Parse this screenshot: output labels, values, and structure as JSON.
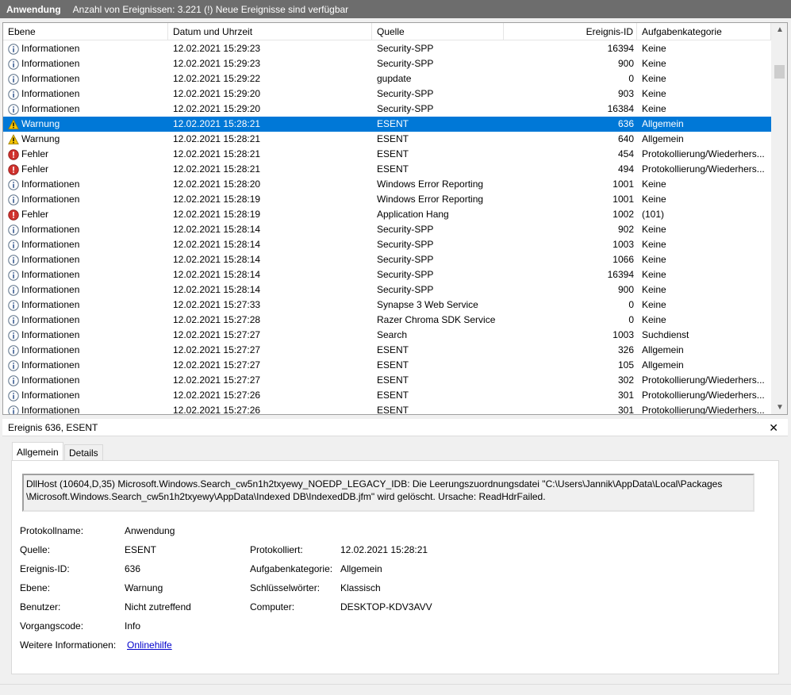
{
  "title": {
    "app_name": "Anwendung",
    "count_text": "Anzahl von Ereignissen: 3.221 (!) Neue Ereignisse sind verfügbar"
  },
  "columns": {
    "level": "Ebene",
    "date": "Datum und Uhrzeit",
    "source": "Quelle",
    "event_id": "Ereignis-ID",
    "category": "Aufgabenkategorie"
  },
  "events": [
    {
      "level": "Informationen",
      "icon": "info",
      "date": "12.02.2021 15:29:23",
      "source": "Security-SPP",
      "id": "16394",
      "category": "Keine"
    },
    {
      "level": "Informationen",
      "icon": "info",
      "date": "12.02.2021 15:29:23",
      "source": "Security-SPP",
      "id": "900",
      "category": "Keine"
    },
    {
      "level": "Informationen",
      "icon": "info",
      "date": "12.02.2021 15:29:22",
      "source": "gupdate",
      "id": "0",
      "category": "Keine"
    },
    {
      "level": "Informationen",
      "icon": "info",
      "date": "12.02.2021 15:29:20",
      "source": "Security-SPP",
      "id": "903",
      "category": "Keine"
    },
    {
      "level": "Informationen",
      "icon": "info",
      "date": "12.02.2021 15:29:20",
      "source": "Security-SPP",
      "id": "16384",
      "category": "Keine"
    },
    {
      "level": "Warnung",
      "icon": "warning",
      "date": "12.02.2021 15:28:21",
      "source": "ESENT",
      "id": "636",
      "category": "Allgemein",
      "selected": true
    },
    {
      "level": "Warnung",
      "icon": "warning",
      "date": "12.02.2021 15:28:21",
      "source": "ESENT",
      "id": "640",
      "category": "Allgemein"
    },
    {
      "level": "Fehler",
      "icon": "error",
      "date": "12.02.2021 15:28:21",
      "source": "ESENT",
      "id": "454",
      "category": "Protokollierung/Wiederhers..."
    },
    {
      "level": "Fehler",
      "icon": "error",
      "date": "12.02.2021 15:28:21",
      "source": "ESENT",
      "id": "494",
      "category": "Protokollierung/Wiederhers..."
    },
    {
      "level": "Informationen",
      "icon": "info",
      "date": "12.02.2021 15:28:20",
      "source": "Windows Error Reporting",
      "id": "1001",
      "category": "Keine"
    },
    {
      "level": "Informationen",
      "icon": "info",
      "date": "12.02.2021 15:28:19",
      "source": "Windows Error Reporting",
      "id": "1001",
      "category": "Keine"
    },
    {
      "level": "Fehler",
      "icon": "error",
      "date": "12.02.2021 15:28:19",
      "source": "Application Hang",
      "id": "1002",
      "category": "(101)"
    },
    {
      "level": "Informationen",
      "icon": "info",
      "date": "12.02.2021 15:28:14",
      "source": "Security-SPP",
      "id": "902",
      "category": "Keine"
    },
    {
      "level": "Informationen",
      "icon": "info",
      "date": "12.02.2021 15:28:14",
      "source": "Security-SPP",
      "id": "1003",
      "category": "Keine"
    },
    {
      "level": "Informationen",
      "icon": "info",
      "date": "12.02.2021 15:28:14",
      "source": "Security-SPP",
      "id": "1066",
      "category": "Keine"
    },
    {
      "level": "Informationen",
      "icon": "info",
      "date": "12.02.2021 15:28:14",
      "source": "Security-SPP",
      "id": "16394",
      "category": "Keine"
    },
    {
      "level": "Informationen",
      "icon": "info",
      "date": "12.02.2021 15:28:14",
      "source": "Security-SPP",
      "id": "900",
      "category": "Keine"
    },
    {
      "level": "Informationen",
      "icon": "info",
      "date": "12.02.2021 15:27:33",
      "source": "Synapse 3 Web Service",
      "id": "0",
      "category": "Keine"
    },
    {
      "level": "Informationen",
      "icon": "info",
      "date": "12.02.2021 15:27:28",
      "source": "Razer Chroma SDK Service",
      "id": "0",
      "category": "Keine"
    },
    {
      "level": "Informationen",
      "icon": "info",
      "date": "12.02.2021 15:27:27",
      "source": "Search",
      "id": "1003",
      "category": "Suchdienst"
    },
    {
      "level": "Informationen",
      "icon": "info",
      "date": "12.02.2021 15:27:27",
      "source": "ESENT",
      "id": "326",
      "category": "Allgemein"
    },
    {
      "level": "Informationen",
      "icon": "info",
      "date": "12.02.2021 15:27:27",
      "source": "ESENT",
      "id": "105",
      "category": "Allgemein"
    },
    {
      "level": "Informationen",
      "icon": "info",
      "date": "12.02.2021 15:27:27",
      "source": "ESENT",
      "id": "302",
      "category": "Protokollierung/Wiederhers..."
    },
    {
      "level": "Informationen",
      "icon": "info",
      "date": "12.02.2021 15:27:26",
      "source": "ESENT",
      "id": "301",
      "category": "Protokollierung/Wiederhers..."
    },
    {
      "level": "Informationen",
      "icon": "info",
      "date": "12.02.2021 15:27:26",
      "source": "ESENT",
      "id": "301",
      "category": "Protokollierung/Wiederhers..."
    }
  ],
  "detail": {
    "header": "Ereignis 636, ESENT",
    "close_glyph": "✕",
    "tabs": [
      "Allgemein",
      "Details"
    ],
    "message_line1": "DllHost (10604,D,35) Microsoft.Windows.Search_cw5n1h2txyewy_NOEDP_LEGACY_IDB: Die Leerungszuordnungsdatei \"C:\\Users\\Jannik\\AppData\\Local\\Packages",
    "message_line2": "\\Microsoft.Windows.Search_cw5n1h2txyewy\\AppData\\Indexed DB\\IndexedDB.jfm\" wird gelöscht. Ursache: ReadHdrFailed.",
    "fields": {
      "log_name_label": "Protokollname:",
      "log_name": "Anwendung",
      "source_label": "Quelle:",
      "source": "ESENT",
      "logged_label": "Protokolliert:",
      "logged": "12.02.2021 15:28:21",
      "event_id_label": "Ereignis-ID:",
      "event_id": "636",
      "task_category_label": "Aufgabenkategorie:",
      "task_category": "Allgemein",
      "level_label": "Ebene:",
      "level": "Warnung",
      "keywords_label": "Schlüsselwörter:",
      "keywords": "Klassisch",
      "user_label": "Benutzer:",
      "user": "Nicht zutreffend",
      "computer_label": "Computer:",
      "computer": "DESKTOP-KDV3AVV",
      "opcode_label": "Vorgangscode:",
      "opcode": "Info",
      "more_info_label": "Weitere Informationen:",
      "more_info_link": "Onlinehilfe"
    }
  }
}
